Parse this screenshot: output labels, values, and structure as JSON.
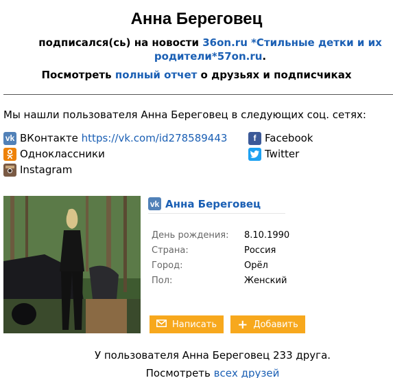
{
  "header": {
    "name": "Анна Береговец",
    "subscribed_prefix": "подписался(сь) на новости",
    "subscribed_link": "36on.ru *Стильные детки и их родители*57on.ru",
    "subscribed_suffix": ".",
    "report_prefix": "Посмотреть",
    "report_link": "полный отчет",
    "report_suffix": "о друзьях и подписчиках"
  },
  "found_text": "Мы нашли пользователя Анна Береговец в следующих соц. сетях:",
  "networks": {
    "vk_label": "ВКонтакте",
    "vk_url": "https://vk.com/id278589443",
    "ok_label": "Одноклассники",
    "instagram_label": "Instagram",
    "facebook_label": "Facebook",
    "twitter_label": "Twitter"
  },
  "profile": {
    "name": "Анна Береговец",
    "fields": [
      {
        "label": "День рождения:",
        "value": "8.10.1990"
      },
      {
        "label": "Страна:",
        "value": "Россия"
      },
      {
        "label": "Город:",
        "value": "Орёл"
      },
      {
        "label": "Пол:",
        "value": "Женский"
      }
    ],
    "write_button": "Написать",
    "add_button": "Добавить"
  },
  "friends": {
    "count_text": "У пользователя Анна Береговец 233 друга.",
    "view_prefix": "Посмотреть",
    "view_link": "всех друзей"
  },
  "colors": {
    "link": "#1a5fb4",
    "button": "#f7a81d",
    "vk": "#5181b8",
    "ok": "#ee8208",
    "facebook": "#3b5998",
    "twitter": "#1da1f2"
  }
}
